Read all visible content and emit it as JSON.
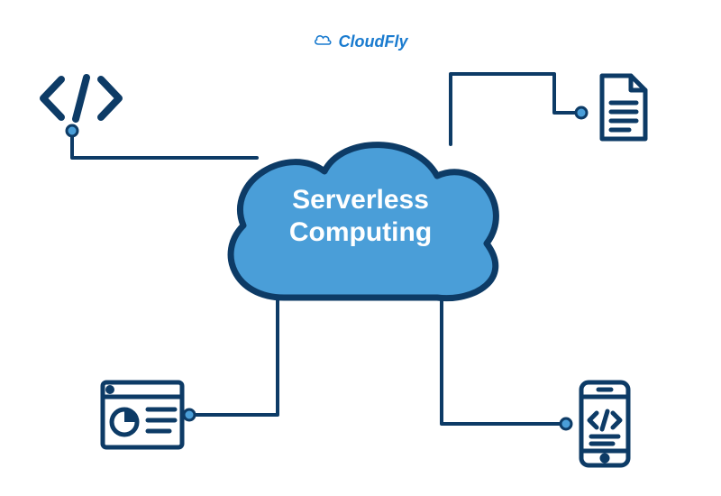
{
  "brand": {
    "name": "CloudFly"
  },
  "center": {
    "title": "Serverless\nComputing"
  },
  "colors": {
    "primary": "#4a9ed8",
    "outline": "#0d3b66",
    "brand": "#1a7bcf"
  },
  "nodes": {
    "code": "code-icon",
    "document": "document-icon",
    "analytics": "analytics-dashboard-icon",
    "mobile": "mobile-code-icon"
  }
}
